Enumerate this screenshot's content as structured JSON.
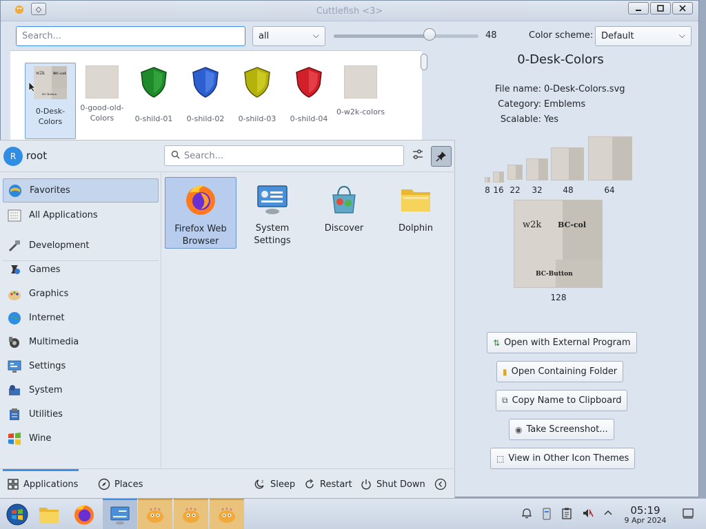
{
  "window": {
    "title": "Cuttlefish <3>",
    "search_placeholder": "Search...",
    "filter_value": "all",
    "size_value": "48",
    "size_fraction": 0.66,
    "color_scheme_label": "Color scheme:",
    "color_scheme_value": "Default"
  },
  "icons": [
    {
      "label": "0-Desk-Colors"
    },
    {
      "label": "0-good-old-Colors"
    },
    {
      "label": "0-shild-01",
      "color": "#1f8a2a"
    },
    {
      "label": "0-shild-02",
      "color": "#2d5fd1"
    },
    {
      "label": "0-shild-03",
      "color": "#b5b20c"
    },
    {
      "label": "0-shild-04",
      "color": "#d1202a"
    },
    {
      "label": "0-w2k-colors"
    }
  ],
  "details": {
    "title": "0-Desk-Colors",
    "file_name_key": "File name:",
    "file_name": "0-Desk-Colors.svg",
    "category_key": "Category:",
    "category": "Emblems",
    "scalable_key": "Scalable:",
    "scalable": "Yes",
    "sizes": [
      "8",
      "16",
      "22",
      "32",
      "48",
      "64",
      "128"
    ],
    "preview_text": {
      "w2k": "w2k",
      "bccol": "BC-col",
      "bcbutton": "BC-Button"
    },
    "buttons": {
      "open_external": "Open with External Program",
      "open_folder": "Open Containing Folder",
      "copy_name": "Copy Name to Clipboard",
      "screenshot": "Take Screenshot...",
      "other_themes": "View in Other Icon Themes"
    }
  },
  "launcher": {
    "avatar_letter": "R",
    "user": "root",
    "search_placeholder": "Search...",
    "categories": [
      {
        "label": "Favorites"
      },
      {
        "label": "All Applications"
      },
      {
        "label": "Development"
      },
      {
        "label": "Games"
      },
      {
        "label": "Graphics"
      },
      {
        "label": "Internet"
      },
      {
        "label": "Multimedia"
      },
      {
        "label": "Settings"
      },
      {
        "label": "System"
      },
      {
        "label": "Utilities"
      },
      {
        "label": "Wine"
      }
    ],
    "apps": [
      {
        "line1": "Firefox Web",
        "line2": "Browser"
      },
      {
        "line1": "System",
        "line2": "Settings"
      },
      {
        "line1": "Discover",
        "line2": ""
      },
      {
        "line1": "Dolphin",
        "line2": ""
      }
    ],
    "footer": {
      "applications": "Applications",
      "places": "Places",
      "sleep": "Sleep",
      "restart": "Restart",
      "shutdown": "Shut Down"
    }
  },
  "taskbar": {
    "time": "05:19",
    "date": "9 Apr 2024"
  }
}
